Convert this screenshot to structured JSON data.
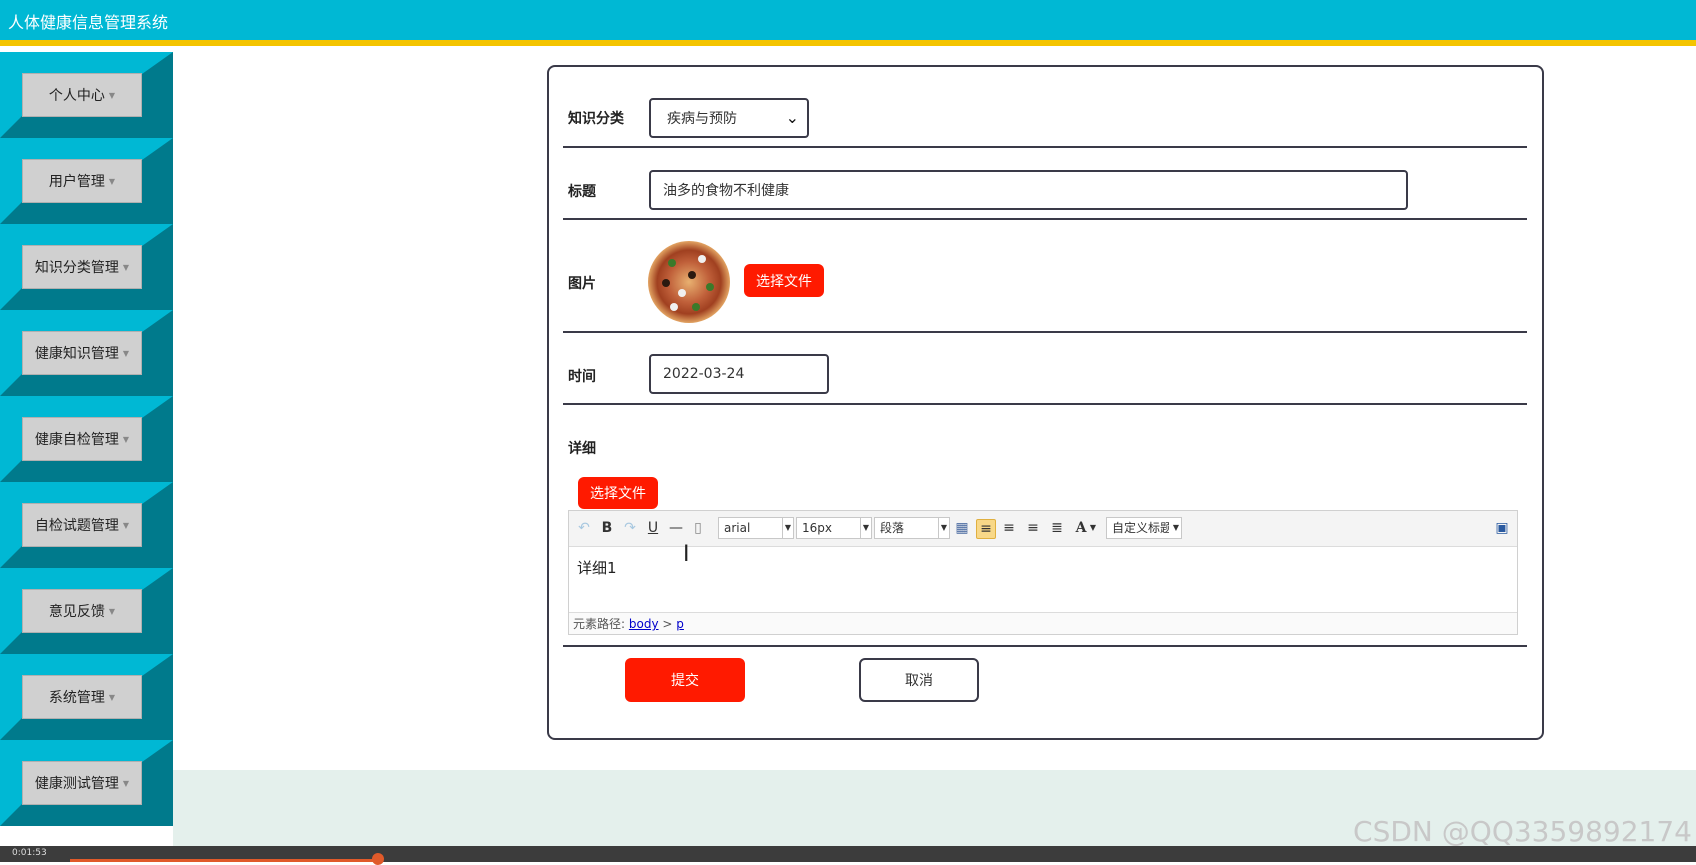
{
  "app": {
    "title": "人体健康信息管理系统"
  },
  "sidebar": {
    "items": [
      {
        "label": "个人中心"
      },
      {
        "label": "用户管理"
      },
      {
        "label": "知识分类管理"
      },
      {
        "label": "健康知识管理"
      },
      {
        "label": "健康自检管理"
      },
      {
        "label": "自检试题管理"
      },
      {
        "label": "意见反馈"
      },
      {
        "label": "系统管理"
      },
      {
        "label": "健康测试管理"
      }
    ]
  },
  "form": {
    "category": {
      "label": "知识分类",
      "value": "疾病与预防"
    },
    "title": {
      "label": "标题",
      "value": "油多的食物不利健康"
    },
    "image": {
      "label": "图片",
      "upload_label": "选择文件"
    },
    "time": {
      "label": "时间",
      "value": "2022-03-24"
    },
    "detail": {
      "label": "详细",
      "upload_label": "选择文件",
      "toolbar": {
        "font_family": "arial",
        "font_size": "16px",
        "paragraph": "段落",
        "custom_heading": "自定义标题"
      },
      "content": "详细1",
      "path_label": "元素路径:",
      "path_body": "body",
      "path_sep": ">",
      "path_p": "p"
    },
    "submit_label": "提交",
    "cancel_label": "取消"
  },
  "watermark": "CSDN @QQ3359892174",
  "video": {
    "time": "0:01:53",
    "progress": 0.2
  },
  "colors": {
    "header": "#00b8d4",
    "accent_bar": "#f4c400",
    "sidebar_dark": "#007a8c",
    "primary_button": "#ff1a00"
  }
}
